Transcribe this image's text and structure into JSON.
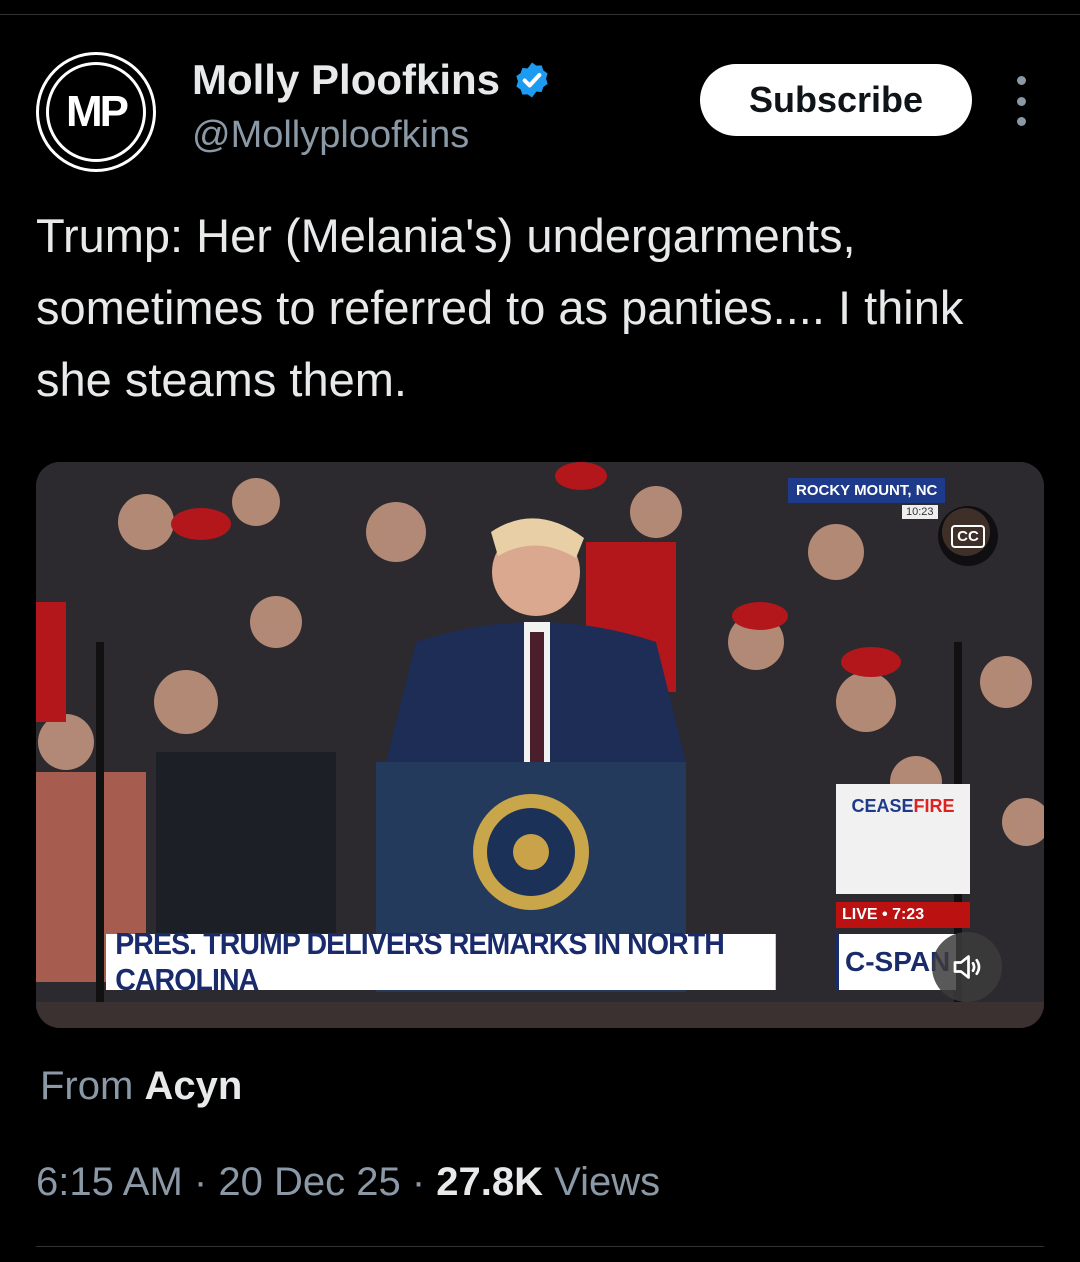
{
  "author": {
    "avatar_initials": "MP",
    "display_name": "Molly Ploofkins",
    "handle": "@Mollyploofkins",
    "verified_icon": "verified-badge-icon"
  },
  "header": {
    "subscribe_label": "Subscribe",
    "more_icon": "more-vertical-icon"
  },
  "tweet": {
    "text": "Trump: Her (Melania's) undergarments, sometimes to referred to as panties.... I think she steams them."
  },
  "media": {
    "lower_third": "PRES. TRUMP DELIVERS REMARKS IN NORTH CAROLINA",
    "network": "C-SPAN",
    "location": "ROCKY MOUNT, NC",
    "location_time": "10:23",
    "cc_label": "CC",
    "ceasefire_prefix": "CEASE",
    "ceasefire_suffix": "FIRE",
    "live_label": "LIVE",
    "live_time": "7:23",
    "mute_icon": "speaker-icon",
    "accent_color": "#1e3a8a"
  },
  "footer": {
    "from_prefix": "From",
    "from_name": "Acyn",
    "time": "6:15 AM",
    "date": "20 Dec 25",
    "views_count": "27.8K",
    "views_label": "Views",
    "separator": "·"
  }
}
